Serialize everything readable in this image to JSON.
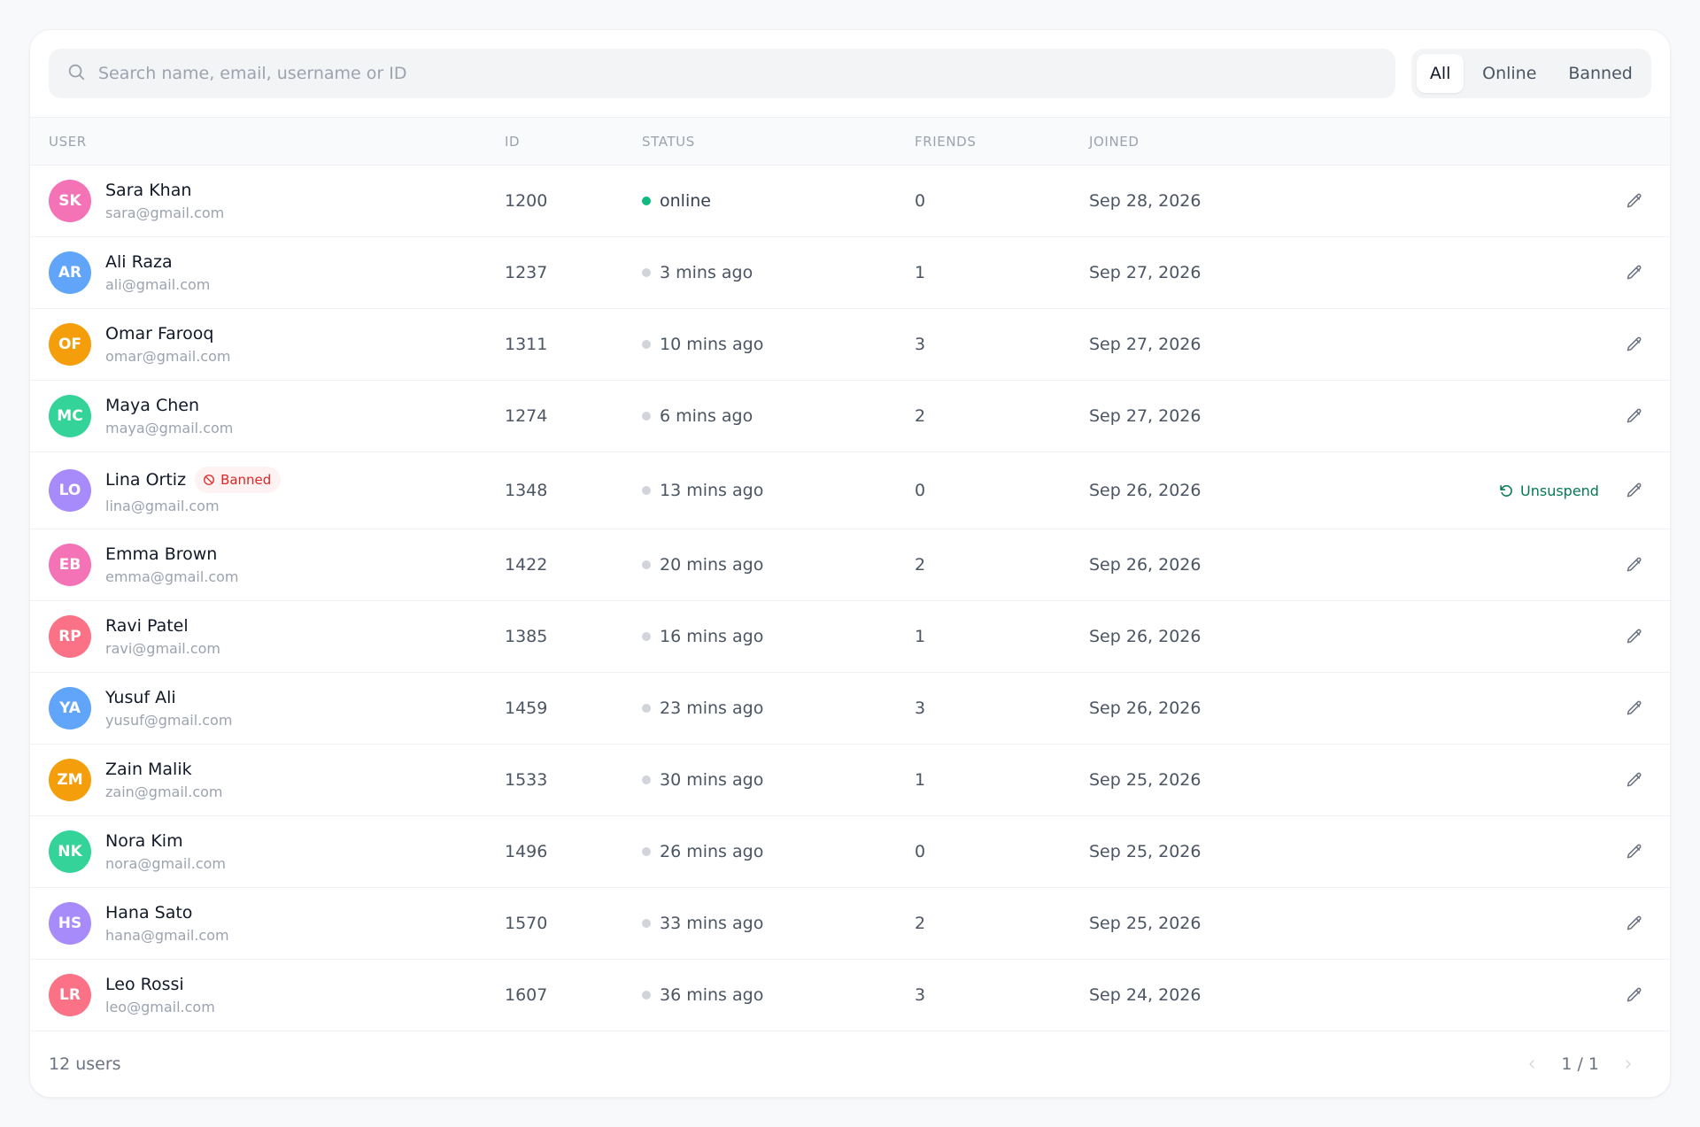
{
  "search": {
    "placeholder": "Search name, email, username or ID"
  },
  "filters": [
    {
      "label": "All",
      "active": true
    },
    {
      "label": "Online",
      "active": false
    },
    {
      "label": "Banned",
      "active": false
    }
  ],
  "columns": {
    "user": "USER",
    "id": "ID",
    "status": "STATUS",
    "friends": "FRIENDS",
    "joined": "JOINED"
  },
  "users": [
    {
      "initials": "SK",
      "name": "Sara Khan",
      "email": "sara@gmail.com",
      "id": "1200",
      "status": "online",
      "friends": "0",
      "joined": "Sep 28, 2026",
      "banned": false,
      "color": "#f472b6"
    },
    {
      "initials": "AR",
      "name": "Ali Raza",
      "email": "ali@gmail.com",
      "id": "1237",
      "status": "3 mins ago",
      "friends": "1",
      "joined": "Sep 27, 2026",
      "banned": false,
      "color": "#60a5fa"
    },
    {
      "initials": "OF",
      "name": "Omar Farooq",
      "email": "omar@gmail.com",
      "id": "1311",
      "status": "10 mins ago",
      "friends": "3",
      "joined": "Sep 27, 2026",
      "banned": false,
      "color": "#f59e0b"
    },
    {
      "initials": "MC",
      "name": "Maya Chen",
      "email": "maya@gmail.com",
      "id": "1274",
      "status": "6 mins ago",
      "friends": "2",
      "joined": "Sep 27, 2026",
      "banned": false,
      "color": "#34d399"
    },
    {
      "initials": "LO",
      "name": "Lina Ortiz",
      "email": "lina@gmail.com",
      "id": "1348",
      "status": "13 mins ago",
      "friends": "0",
      "joined": "Sep 26, 2026",
      "banned": true,
      "color": "#a78bfa"
    },
    {
      "initials": "EB",
      "name": "Emma Brown",
      "email": "emma@gmail.com",
      "id": "1422",
      "status": "20 mins ago",
      "friends": "2",
      "joined": "Sep 26, 2026",
      "banned": false,
      "color": "#f472b6"
    },
    {
      "initials": "RP",
      "name": "Ravi Patel",
      "email": "ravi@gmail.com",
      "id": "1385",
      "status": "16 mins ago",
      "friends": "1",
      "joined": "Sep 26, 2026",
      "banned": false,
      "color": "#fb7185"
    },
    {
      "initials": "YA",
      "name": "Yusuf Ali",
      "email": "yusuf@gmail.com",
      "id": "1459",
      "status": "23 mins ago",
      "friends": "3",
      "joined": "Sep 26, 2026",
      "banned": false,
      "color": "#60a5fa"
    },
    {
      "initials": "ZM",
      "name": "Zain Malik",
      "email": "zain@gmail.com",
      "id": "1533",
      "status": "30 mins ago",
      "friends": "1",
      "joined": "Sep 25, 2026",
      "banned": false,
      "color": "#f59e0b"
    },
    {
      "initials": "NK",
      "name": "Nora Kim",
      "email": "nora@gmail.com",
      "id": "1496",
      "status": "26 mins ago",
      "friends": "0",
      "joined": "Sep 25, 2026",
      "banned": false,
      "color": "#34d399"
    },
    {
      "initials": "HS",
      "name": "Hana Sato",
      "email": "hana@gmail.com",
      "id": "1570",
      "status": "33 mins ago",
      "friends": "2",
      "joined": "Sep 25, 2026",
      "banned": false,
      "color": "#a78bfa"
    },
    {
      "initials": "LR",
      "name": "Leo Rossi",
      "email": "leo@gmail.com",
      "id": "1607",
      "status": "36 mins ago",
      "friends": "3",
      "joined": "Sep 24, 2026",
      "banned": false,
      "color": "#fb7185"
    }
  ],
  "labels": {
    "banned_badge": "Banned",
    "unsuspend": "Unsuspend"
  },
  "footer": {
    "count": "12 users",
    "pages": "1 / 1"
  },
  "icons": {
    "search": "search-icon",
    "ban": "ban-icon",
    "unsuspend": "rotate-ccw-icon",
    "edit": "pencil-icon",
    "prev": "chevron-left-icon",
    "next": "chevron-right-icon"
  },
  "colors": {
    "online": "#10b981",
    "offline": "#d1d5db",
    "banned": "#dc2626",
    "unsuspend": "#047857"
  }
}
